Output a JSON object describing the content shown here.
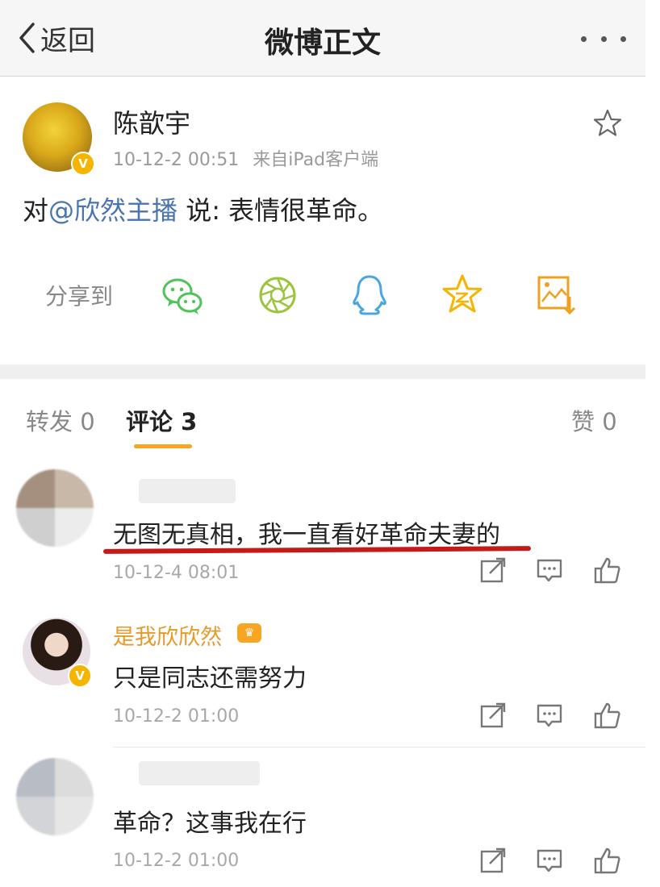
{
  "nav": {
    "back_label": "返回",
    "title": "微博正文"
  },
  "post": {
    "author": "陈歆宇",
    "time": "10-12-2 00:51",
    "source": "来自iPad客户端",
    "text_prefix": "对",
    "mention": "@欣然主播",
    "text_suffix": " 说: 表情很革命。",
    "verified_badge": "V"
  },
  "share": {
    "label": "分享到",
    "targets": [
      "wechat-icon",
      "moments-icon",
      "qq-icon",
      "qzone-icon",
      "save-image-icon"
    ]
  },
  "tabs": {
    "repost": "转发 0",
    "comments": "评论 3",
    "likes": "赞 0"
  },
  "comments": [
    {
      "name": "",
      "text": "无图无真相，我一直看好革命夫妻的",
      "time": "10-12-4 08:01"
    },
    {
      "name": "是我欣欣然",
      "text": "只是同志还需努力",
      "time": "10-12-2 01:00",
      "verified_badge": "V"
    },
    {
      "name": "",
      "text": "革命？这事我在行",
      "time": "10-12-2 01:00"
    }
  ],
  "colors": {
    "accent": "#f7a325",
    "mention": "#4a74b0",
    "username_orange": "#e59a2b",
    "annotation_red": "#c41a1a"
  }
}
